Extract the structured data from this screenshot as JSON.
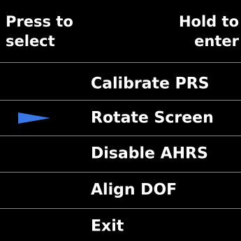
{
  "header": {
    "press_hint": "Press to\nselect",
    "hold_hint": "Hold to\nenter"
  },
  "menu": {
    "items": [
      {
        "label": "Calibrate PRS"
      },
      {
        "label": "Rotate Screen",
        "selected": true
      },
      {
        "label": "Disable AHRS"
      },
      {
        "label": "Align DOF"
      },
      {
        "label": "Exit"
      }
    ]
  },
  "colors": {
    "background": "#000000",
    "text": "#ffffff",
    "divider": "#8a8a8a",
    "cursor": "#3a78e6"
  },
  "icons": {
    "selection_cursor": "triangle-pointer-icon"
  }
}
